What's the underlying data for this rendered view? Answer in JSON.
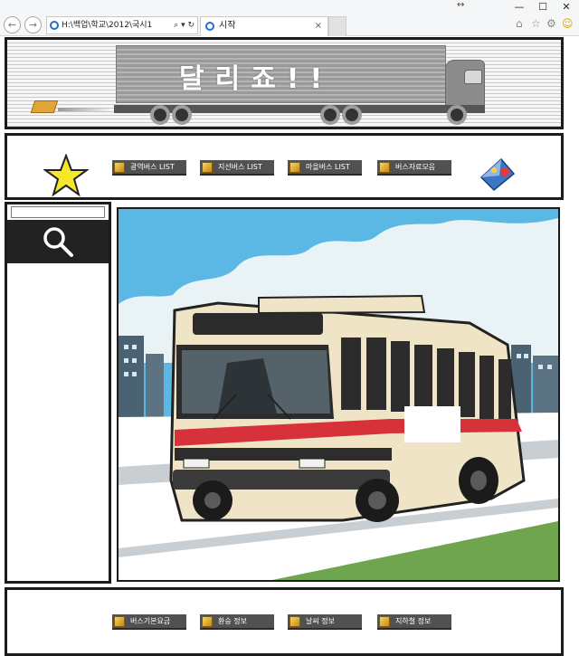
{
  "browser": {
    "address": "H:\\백업\\학교\\2012\\국시1",
    "address_tools": "⌕ ▾ ↻",
    "tab_title": "시작",
    "tab_close": "×",
    "window_controls": [
      "—",
      "☐",
      "✕"
    ],
    "toolbar_icons": [
      "home-icon",
      "favorites-star-icon",
      "settings-gear-icon",
      "smiley-feedback-icon"
    ]
  },
  "header": {
    "title": "달리죠!!"
  },
  "nav_top": {
    "items": [
      {
        "label": "광역버스 LIST"
      },
      {
        "label": "지선버스 LIST"
      },
      {
        "label": "마을버스 LIST"
      },
      {
        "label": "버스자료모음"
      }
    ]
  },
  "sidebar": {
    "search_placeholder": ""
  },
  "nav_bottom": {
    "items": [
      {
        "label": "버스기본요금"
      },
      {
        "label": "환승 정보"
      },
      {
        "label": "날씨 정보"
      },
      {
        "label": "지하철 정보"
      }
    ]
  },
  "colors": {
    "frame": "#1c1c1c",
    "nav_button": "#515151",
    "sky": "#5bb8e4",
    "grass": "#6fa54e",
    "bus_body": "#efe4c5",
    "bus_stripe": "#d7323a"
  }
}
